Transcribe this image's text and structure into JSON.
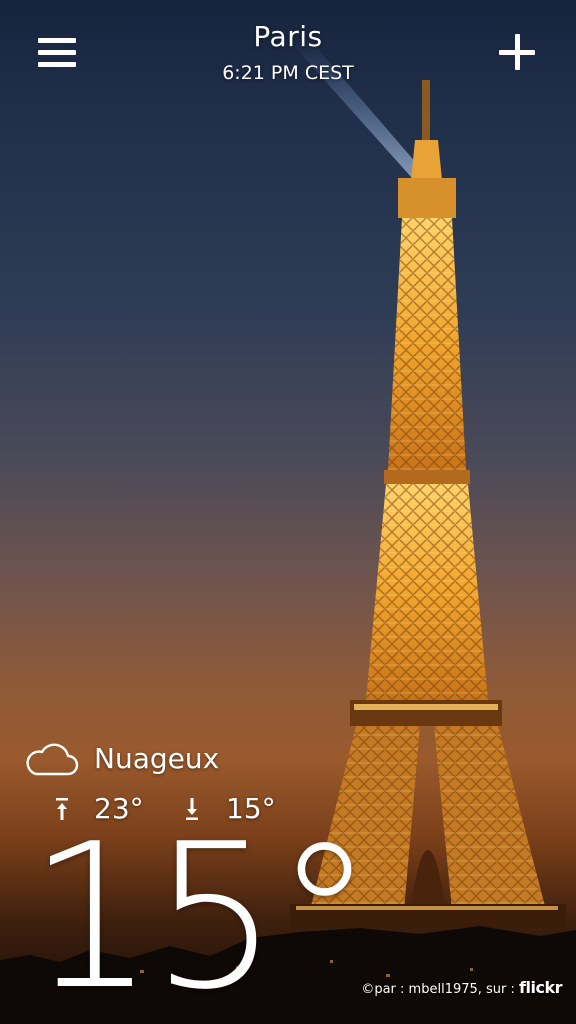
{
  "header": {
    "city": "Paris",
    "local_time": "6:21 PM CEST",
    "menu_icon": "hamburger-menu-icon",
    "add_icon": "plus-icon"
  },
  "weather": {
    "condition_icon": "cloud-icon",
    "condition": "Nuageux",
    "high_icon": "arrow-up-icon",
    "high": "23°",
    "low_icon": "arrow-down-icon",
    "low": "15°",
    "current_temp": "15°"
  },
  "credit": {
    "prefix": "©par : mbell1975, sur : ",
    "brand": "flickr"
  },
  "colors": {
    "sky_top": "#16233d",
    "sky_horizon": "#9a5a2c",
    "tower_light": "#f2b23a",
    "text": "#ffffff"
  }
}
